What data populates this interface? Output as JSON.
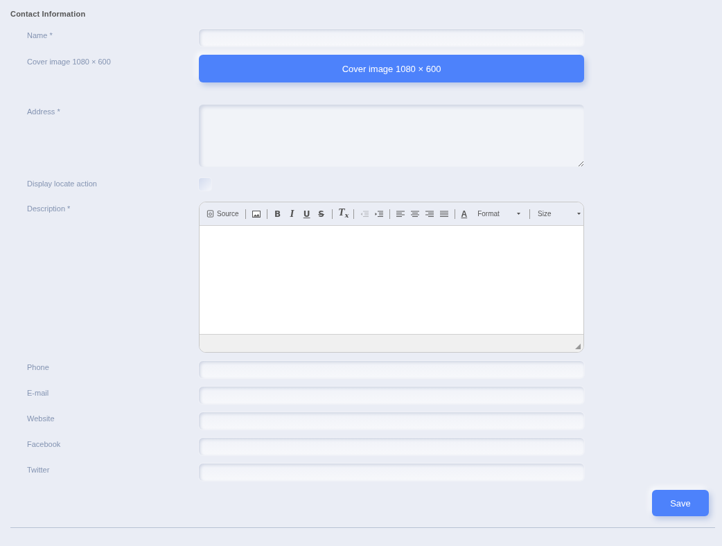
{
  "section_title": "Contact Information",
  "fields": [
    {
      "kind": "text",
      "label": "Name *"
    },
    {
      "kind": "upload",
      "label": "Cover image 1080 × 600",
      "button": "Cover image 1080 × 600"
    },
    {
      "kind": "textarea",
      "label": "Address *"
    },
    {
      "kind": "checkbox",
      "label": "Display locate action",
      "checked": false
    },
    {
      "kind": "editor",
      "label": "Description *"
    },
    {
      "kind": "text",
      "label": "Phone"
    },
    {
      "kind": "text",
      "label": "E-mail"
    },
    {
      "kind": "text",
      "label": "Website"
    },
    {
      "kind": "text",
      "label": "Facebook"
    },
    {
      "kind": "text",
      "label": "Twitter"
    }
  ],
  "editor": {
    "source": "Source",
    "bold": "B",
    "italic": "I",
    "underline": "U",
    "strike": "S",
    "clear": "T$_{x}$",
    "text_color_letter": "A",
    "outdent_disabled": true,
    "format": "Format",
    "size": "Size"
  },
  "save": "Save"
}
